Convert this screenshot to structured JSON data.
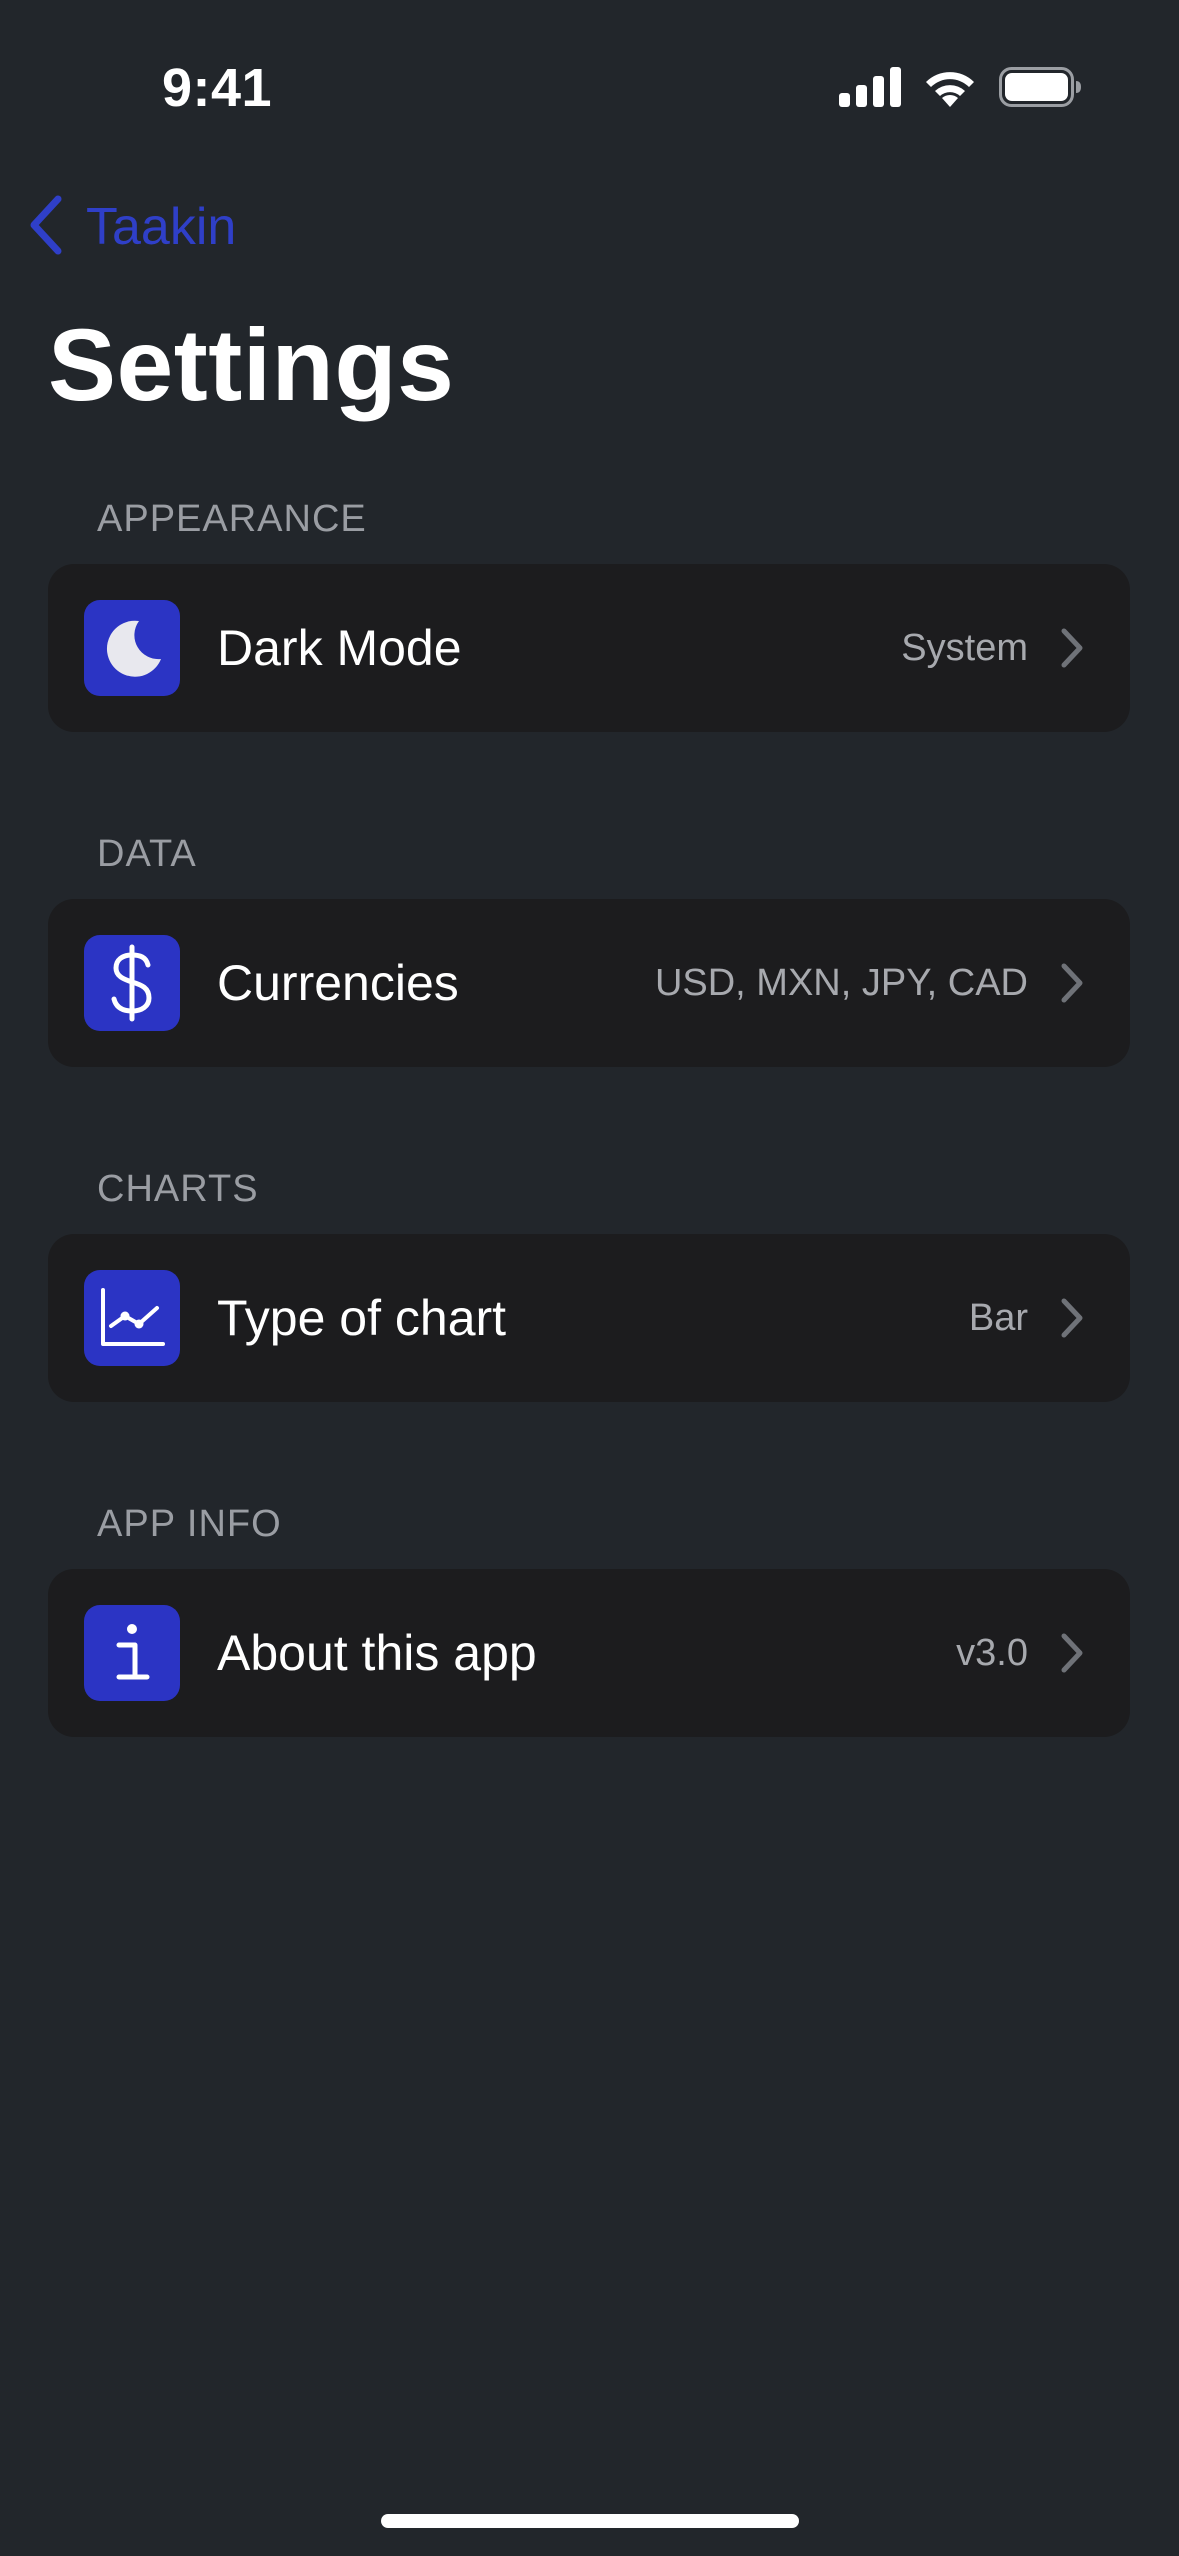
{
  "status_bar": {
    "time": "9:41"
  },
  "nav": {
    "back_label": "Taakin",
    "title": "Settings"
  },
  "colors": {
    "background": "#22262B",
    "card": "#1C1C1E",
    "accent": "#2F3FC8",
    "icon_tile": "#2B34C4",
    "section_header": "#9A9DA3",
    "secondary_text": "#A7A9AE"
  },
  "sections": [
    {
      "header": "APPEARANCE",
      "row": {
        "icon": "moon-icon",
        "label": "Dark Mode",
        "value": "System"
      }
    },
    {
      "header": "DATA",
      "row": {
        "icon": "dollar-icon",
        "label": "Currencies",
        "value": "USD, MXN, JPY, CAD"
      }
    },
    {
      "header": "CHARTS",
      "row": {
        "icon": "line-chart-icon",
        "label": "Type of chart",
        "value": "Bar"
      }
    },
    {
      "header": "APP INFO",
      "row": {
        "icon": "info-icon",
        "label": "About this app",
        "value": "v3.0"
      }
    }
  ]
}
